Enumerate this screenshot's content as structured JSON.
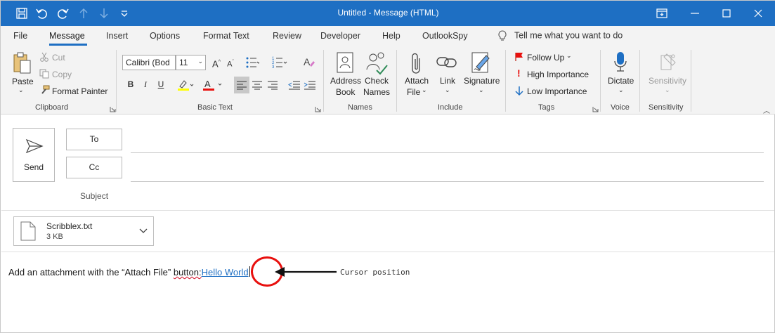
{
  "window": {
    "title": "Untitled  -  Message (HTML)",
    "quick_access": [
      "save-icon",
      "undo-icon",
      "redo-icon",
      "up-arrow-icon",
      "down-arrow-icon",
      "customize-icon"
    ],
    "controls": [
      "ribbon-display-icon",
      "minimize-icon",
      "maximize-icon",
      "close-icon"
    ],
    "accent_color": "#1e6fc3"
  },
  "tabs": {
    "items": [
      "File",
      "Message",
      "Insert",
      "Options",
      "Format Text",
      "Review",
      "Developer",
      "Help",
      "OutlookSpy"
    ],
    "active": "Message",
    "tell_me": "Tell me what you want to do"
  },
  "ribbon": {
    "clipboard": {
      "label": "Clipboard",
      "paste": "Paste",
      "cut": "Cut",
      "copy": "Copy",
      "format_painter": "Format Painter"
    },
    "basic_text": {
      "label": "Basic Text",
      "font": "Calibri (Bod",
      "size": "11",
      "bold": "B",
      "italic": "I",
      "underline": "U"
    },
    "names": {
      "label": "Names",
      "address_book_1": "Address",
      "address_book_2": "Book",
      "check_names_1": "Check",
      "check_names_2": "Names"
    },
    "include": {
      "label": "Include",
      "attach_1": "Attach",
      "attach_2": "File",
      "link": "Link",
      "signature": "Signature"
    },
    "tags": {
      "label": "Tags",
      "follow_up": "Follow Up",
      "high": "High Importance",
      "low": "Low Importance"
    },
    "voice": {
      "label": "Voice",
      "dictate": "Dictate"
    },
    "sensitivity": {
      "label": "Sensitivity",
      "button": "Sensitivity"
    }
  },
  "compose": {
    "send": "Send",
    "to": "To",
    "cc": "Cc",
    "subject": "Subject"
  },
  "attachment": {
    "name": "Scribblex.txt",
    "size": "3 KB"
  },
  "body": {
    "text_before": "Add an attachment with the “Attach File” ",
    "misspelled": "button:",
    "link_text": "Hello World"
  },
  "annotation": {
    "label": "Cursor position",
    "color": "#e8100e"
  }
}
